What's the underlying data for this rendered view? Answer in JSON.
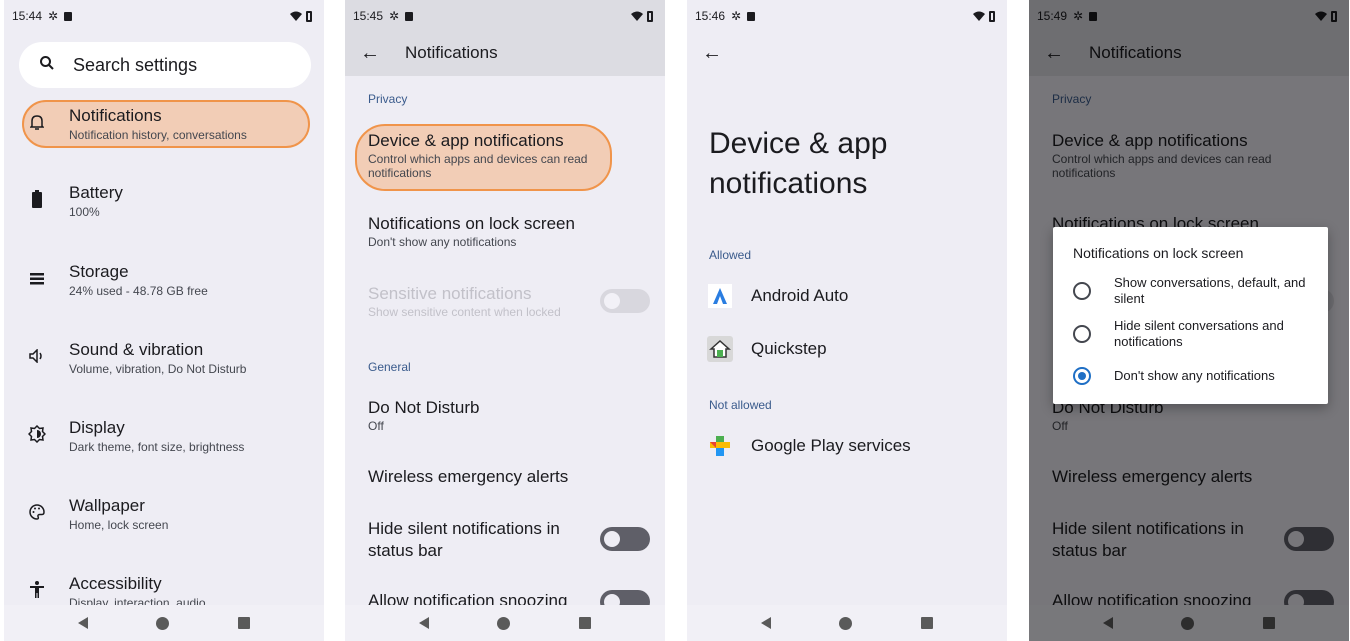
{
  "icons": {
    "settings_status": "gear-icon",
    "sd_card": "sd-card-icon",
    "wifi": "wifi-icon",
    "battery": "battery-icon",
    "search": "search-icon",
    "back": "arrow-back-icon"
  },
  "colors": {
    "highlight_fill": "#f2cdb6",
    "highlight_border": "#f0944a",
    "section_header": "#3a5b8c",
    "radio_selected": "#1f6fc5"
  },
  "panel1": {
    "time": "15:44",
    "search_placeholder": "Search settings",
    "items": [
      {
        "title": "Notifications",
        "subtitle": "Notification history, conversations",
        "icon": "bell-icon"
      },
      {
        "title": "Battery",
        "subtitle": "100%",
        "icon": "battery-icon"
      },
      {
        "title": "Storage",
        "subtitle": "24% used - 48.78 GB free",
        "icon": "storage-icon"
      },
      {
        "title": "Sound & vibration",
        "subtitle": "Volume, vibration, Do Not Disturb",
        "icon": "volume-icon"
      },
      {
        "title": "Display",
        "subtitle": "Dark theme, font size, brightness",
        "icon": "display-icon"
      },
      {
        "title": "Wallpaper",
        "subtitle": "Home, lock screen",
        "icon": "palette-icon"
      },
      {
        "title": "Accessibility",
        "subtitle": "Display, interaction, audio",
        "icon": "accessibility-icon"
      }
    ]
  },
  "panel2": {
    "time": "15:45",
    "title": "Notifications",
    "section_privacy": "Privacy",
    "section_general": "General",
    "device_app_title": "Device & app notifications",
    "device_app_sub": "Control which apps and devices can read notifications",
    "lock_title": "Notifications on lock screen",
    "lock_sub": "Don't show any notifications",
    "sensitive_title": "Sensitive notifications",
    "sensitive_sub": "Show sensitive content when locked",
    "dnd_title": "Do Not Disturb",
    "dnd_sub": "Off",
    "wea_title": "Wireless emergency alerts",
    "hide_silent_title": "Hide silent notifications in status bar",
    "snooze_title": "Allow notification snoozing"
  },
  "panel3": {
    "time": "15:46",
    "title": "Device & app notifications",
    "section_allowed": "Allowed",
    "section_not_allowed": "Not allowed",
    "allowed_apps": [
      {
        "name": "Android Auto",
        "icon": "android-auto-icon"
      },
      {
        "name": "Quickstep",
        "icon": "quickstep-icon"
      }
    ],
    "not_allowed_apps": [
      {
        "name": "Google Play services",
        "icon": "google-play-services-icon"
      }
    ]
  },
  "panel4": {
    "time": "15:49",
    "dialog_title": "Notifications on lock screen",
    "options": [
      {
        "label": "Show conversations, default, and silent",
        "selected": false
      },
      {
        "label": "Hide silent conversations and notifications",
        "selected": false
      },
      {
        "label": "Don't show any notifications",
        "selected": true
      }
    ]
  }
}
